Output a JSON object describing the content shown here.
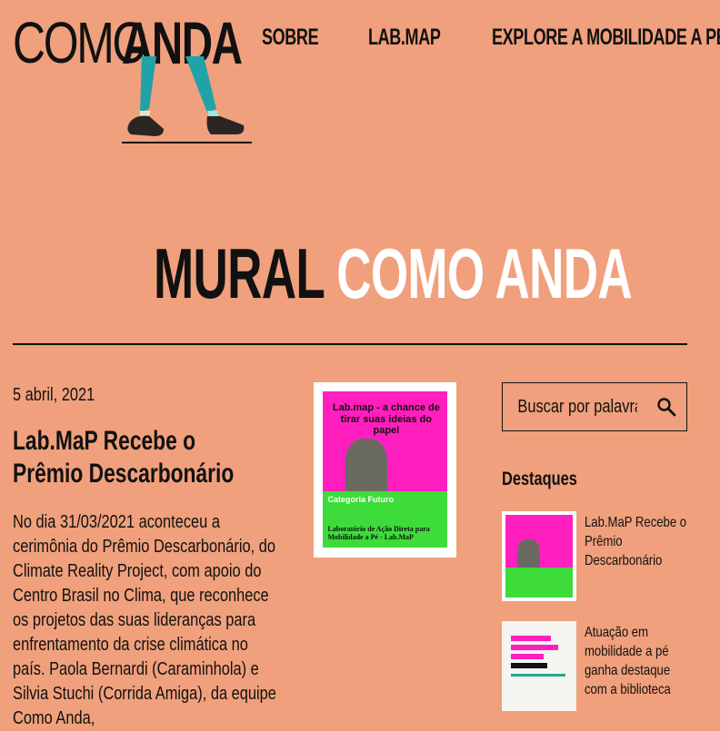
{
  "brand": {
    "word1": "COMO",
    "word2": "ANDA"
  },
  "nav": {
    "sobre": "SOBRE",
    "labmap": "LAB.MAP",
    "explore": "EXPLORE A MOBILIDADE A PÉ"
  },
  "hero": {
    "word1": "MURAL",
    "word2": "COMO ANDA"
  },
  "post": {
    "date": "5 abril, 2021",
    "title": "Lab.MaP Recebe o Prêmio Descarbonário",
    "body": "No dia 31/03/2021 aconteceu a cerimônia do Prêmio Descarbonário, do Climate Reality Project, com apoio do Centro Brasil no Clima, que reconhece os projetos das suas lideranças para enfrentamento da crise climática no país. Paola Bernardi (Caraminhola) e Silvia Stuchi (Corrida Amiga), da equipe Como Anda,"
  },
  "poster": {
    "title": "Lab.map - a chance de tirar suas ideias do papel",
    "category": "Categoria Futuro",
    "subtitle": "Laboratório de Ação Direta para Mobilidade a Pé - Lab.MaP"
  },
  "sidebar": {
    "search_placeholder": "Buscar por palavra",
    "destaques": "Destaques",
    "items": [
      {
        "label": "Lab.MaP Recebe o Prêmio Descarbonário"
      },
      {
        "label": "Atuação em mobilidade a pé ganha destaque com a biblioteca"
      }
    ]
  },
  "colors": {
    "background": "#f0a07c",
    "pink": "#ff1fbf",
    "green": "#3ddc3a",
    "legs": "#1fa3a8"
  }
}
